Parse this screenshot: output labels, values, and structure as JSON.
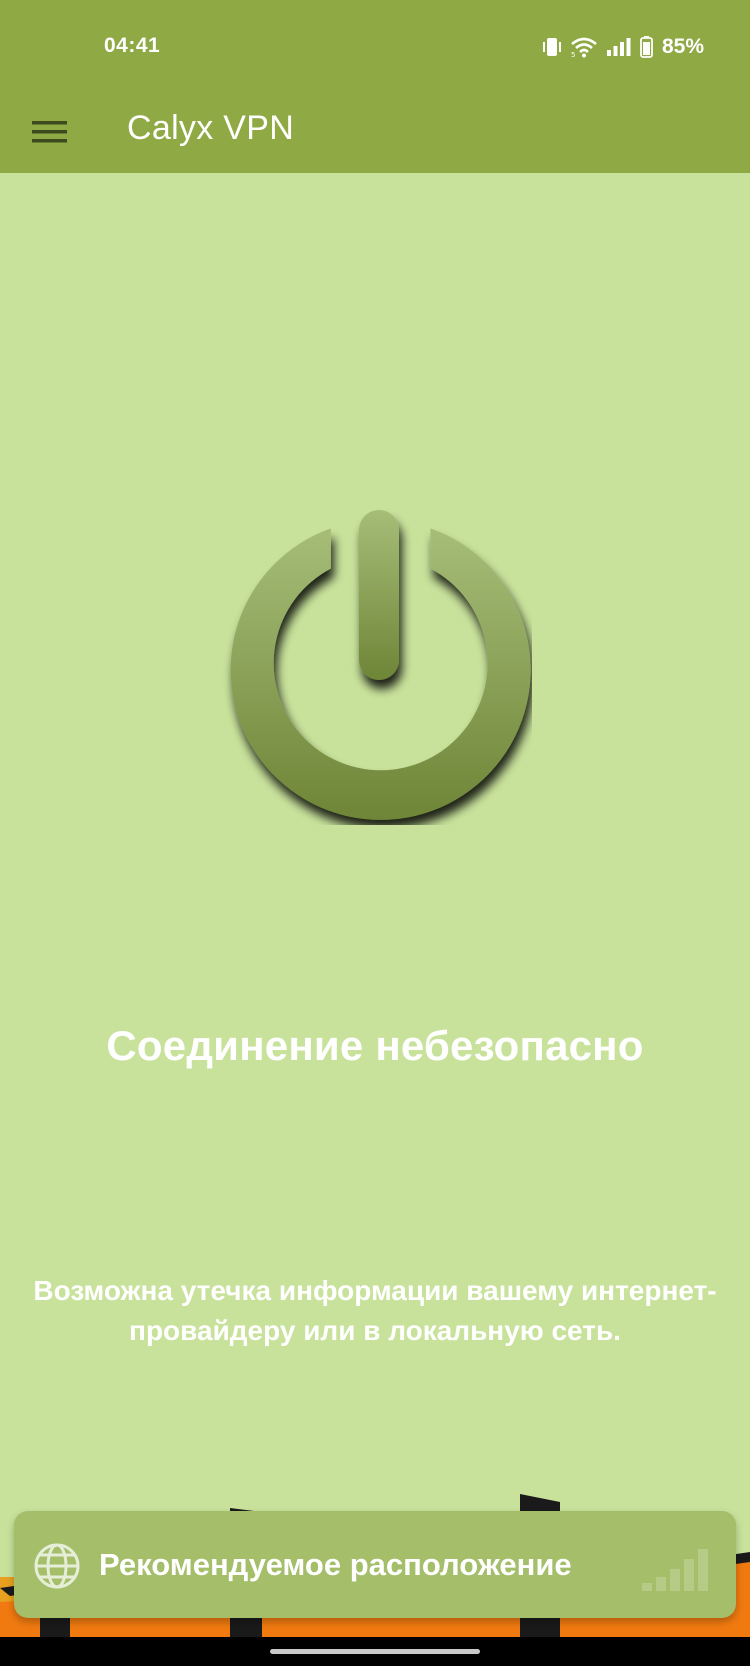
{
  "status_bar": {
    "time": "04:41",
    "battery_text": "85%",
    "icons": [
      "vibrate-icon",
      "wifi-icon",
      "cell-signal-icon",
      "battery-icon"
    ]
  },
  "app_bar": {
    "title": "Calyx VPN",
    "menu_icon": "hamburger-menu-icon"
  },
  "main": {
    "power_icon": "power-icon",
    "status_title": "Соединение небезопасно",
    "description": "Возможна утечка информации вашему интернет-провайдеру или в локальную сеть."
  },
  "location": {
    "icon": "globe-icon",
    "label": "Рекомендуемое расположение",
    "signal_icon": "signal-strength-icon"
  },
  "colors": {
    "app_bar": "#8fa944",
    "background": "#c8e29b",
    "card": "#a4be6a",
    "text": "#ffffff",
    "power_button": "#7d9645"
  }
}
